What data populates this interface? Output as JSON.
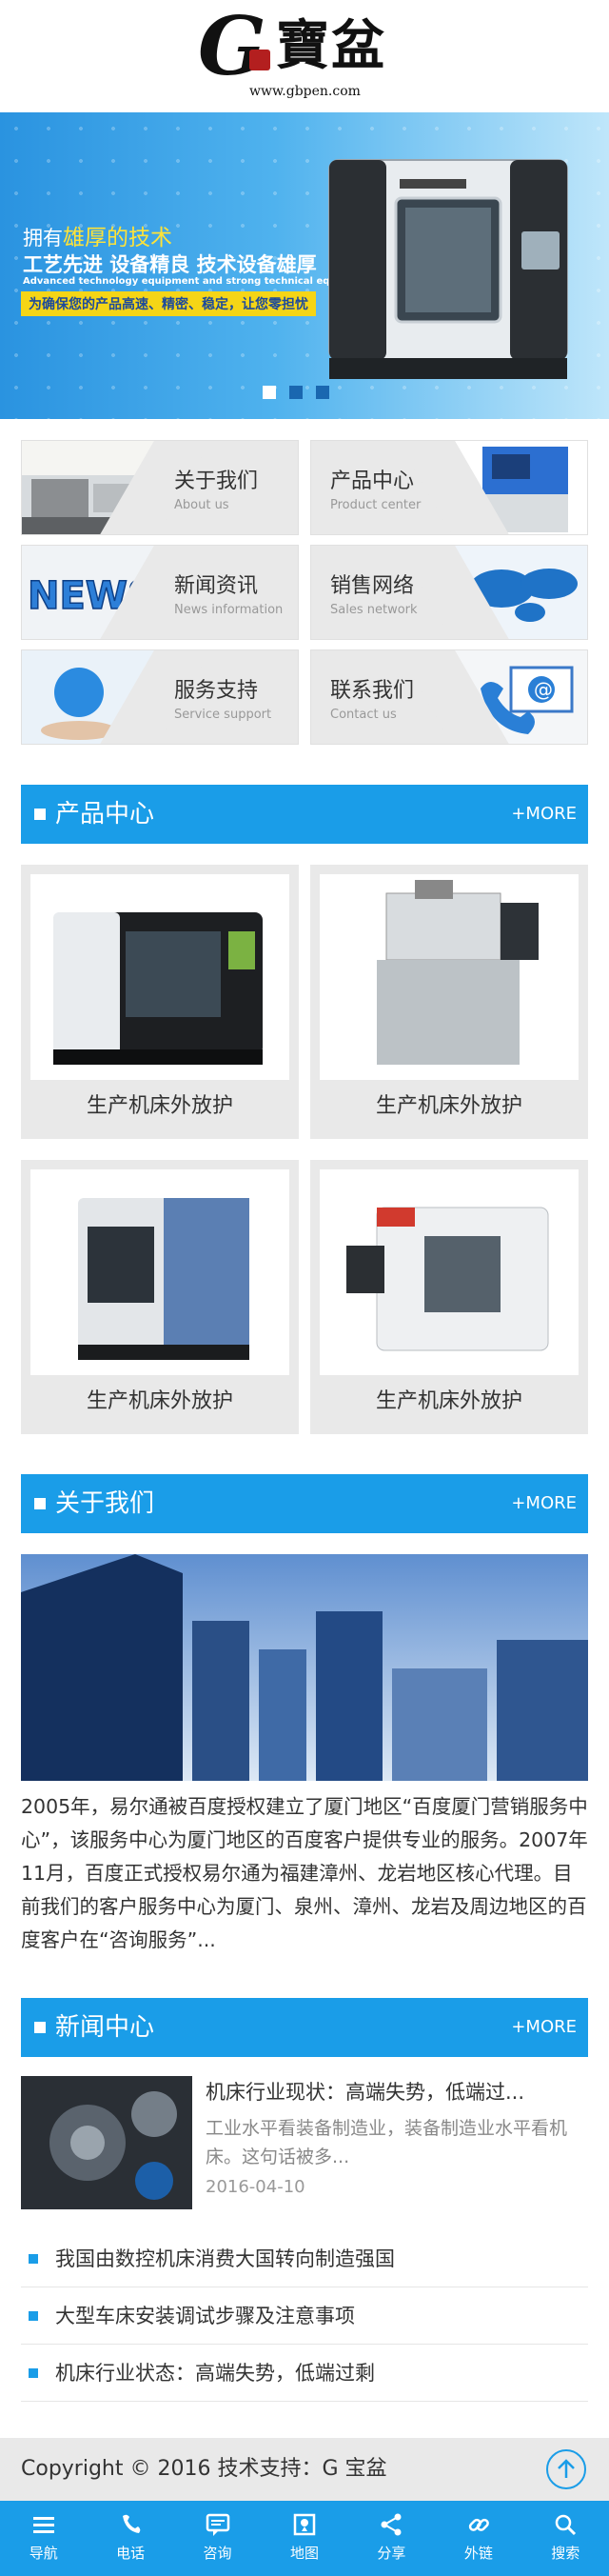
{
  "header": {
    "logo_letter": "G",
    "logo_text": "寶盆",
    "logo_url": "www.gbpen.com"
  },
  "banner": {
    "line1_prefix": "拥有",
    "line1_highlight": "雄厚的技术",
    "line2": "工艺先进  设备精良  技术设备雄厚",
    "line3": "Advanced technology equipment and strong technical equipment",
    "line4": "为确保您的产品高速、精密、稳定，让您零担忧",
    "slide_count": 3,
    "active_slide": 1
  },
  "quick_nav": [
    {
      "title": "关于我们",
      "subtitle": "About us"
    },
    {
      "title": "产品中心",
      "subtitle": "Product center"
    },
    {
      "title": "新闻资讯",
      "subtitle": "News information"
    },
    {
      "title": "销售网络",
      "subtitle": "Sales network"
    },
    {
      "title": "服务支持",
      "subtitle": "Service support"
    },
    {
      "title": "联系我们",
      "subtitle": "Contact us"
    }
  ],
  "products": {
    "title": "产品中心",
    "more": "+MORE",
    "items": [
      {
        "name": "生产机床外放护"
      },
      {
        "name": "生产机床外放护"
      },
      {
        "name": "生产机床外放护"
      },
      {
        "name": "生产机床外放护"
      }
    ]
  },
  "about": {
    "title": "关于我们",
    "more": "+MORE",
    "text": "2005年，易尔通被百度授权建立了厦门地区“百度厦门营销服务中心”，该服务中心为厦门地区的百度客户提供专业的服务。2007年11月，百度正式授权易尔通为福建漳州、龙岩地区核心代理。目前我们的客户服务中心为厦门、泉州、漳州、龙岩及周边地区的百度客户在“咨询服务”..."
  },
  "news": {
    "title": "新闻中心",
    "more": "+MORE",
    "feature": {
      "title": "机床行业现状：高端失势，低端过...",
      "summary": "工业水平看装备制造业，装备制造业水平看机床。这句话被多...",
      "date": "2016-04-10"
    },
    "items": [
      {
        "title": "我国由数控机床消费大国转向制造强国"
      },
      {
        "title": "大型车床安装调试步骤及注意事项"
      },
      {
        "title": "机床行业状态：高端失势，低端过剩"
      }
    ]
  },
  "footer": {
    "copyright": "Copyright © 2016  技术支持：G 宝盆"
  },
  "bottom_nav": [
    {
      "label": "导航",
      "icon": "menu-icon"
    },
    {
      "label": "电话",
      "icon": "phone-icon"
    },
    {
      "label": "咨询",
      "icon": "chat-icon"
    },
    {
      "label": "地图",
      "icon": "map-icon"
    },
    {
      "label": "分享",
      "icon": "share-icon"
    },
    {
      "label": "外链",
      "icon": "link-icon"
    },
    {
      "label": "搜索",
      "icon": "search-icon"
    }
  ],
  "colors": {
    "accent": "#1a9de8",
    "panel": "#e9e9e9",
    "banner_highlight": "#ffe338"
  }
}
